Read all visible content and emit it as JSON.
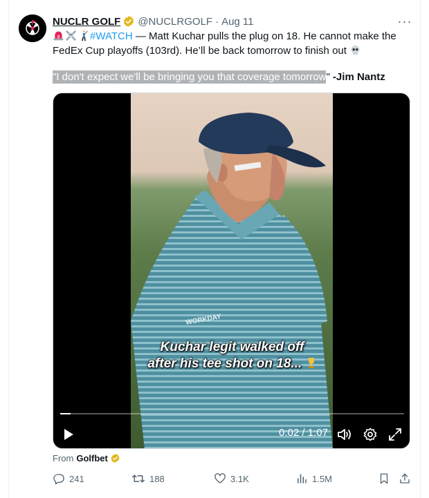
{
  "tweet": {
    "author_name": "NUCLR GOLF",
    "handle": "@NUCLRGOLF",
    "separator": "·",
    "date": "Aug 11",
    "more_label": "···",
    "hashtag": "#WATCH",
    "text_part1": " — Matt Kuchar pulls the plug on 18. He cannot make the",
    "text_part2": "FedEx Cup playoffs (103rd). He’ll be back tomorrow to finish out ",
    "quote": "\"I don't expect we'll be bringing you that coverage tomorrow",
    "quote_close": "\"",
    "attribution": " -Jim Nantz",
    "emojis": [
      "siren-icon",
      "crossbones-icon",
      "golfer-icon",
      "skull-icon"
    ]
  },
  "video": {
    "caption_line1": "Kuchar legit walked off",
    "caption_line2": "after his tee shot on 18... ",
    "current_time": "0:02",
    "time_separator": " / ",
    "duration": "1:07",
    "progress": 0.03
  },
  "source": {
    "label": "From",
    "name": "Golfbet"
  },
  "actions": {
    "replies": "241",
    "reposts": "188",
    "likes": "3.1K",
    "views": "1.5M"
  },
  "colors": {
    "accent": "#1d9bf0",
    "verified": "#e2b719",
    "muted": "#536471",
    "highlight": "#b0b3b6"
  }
}
